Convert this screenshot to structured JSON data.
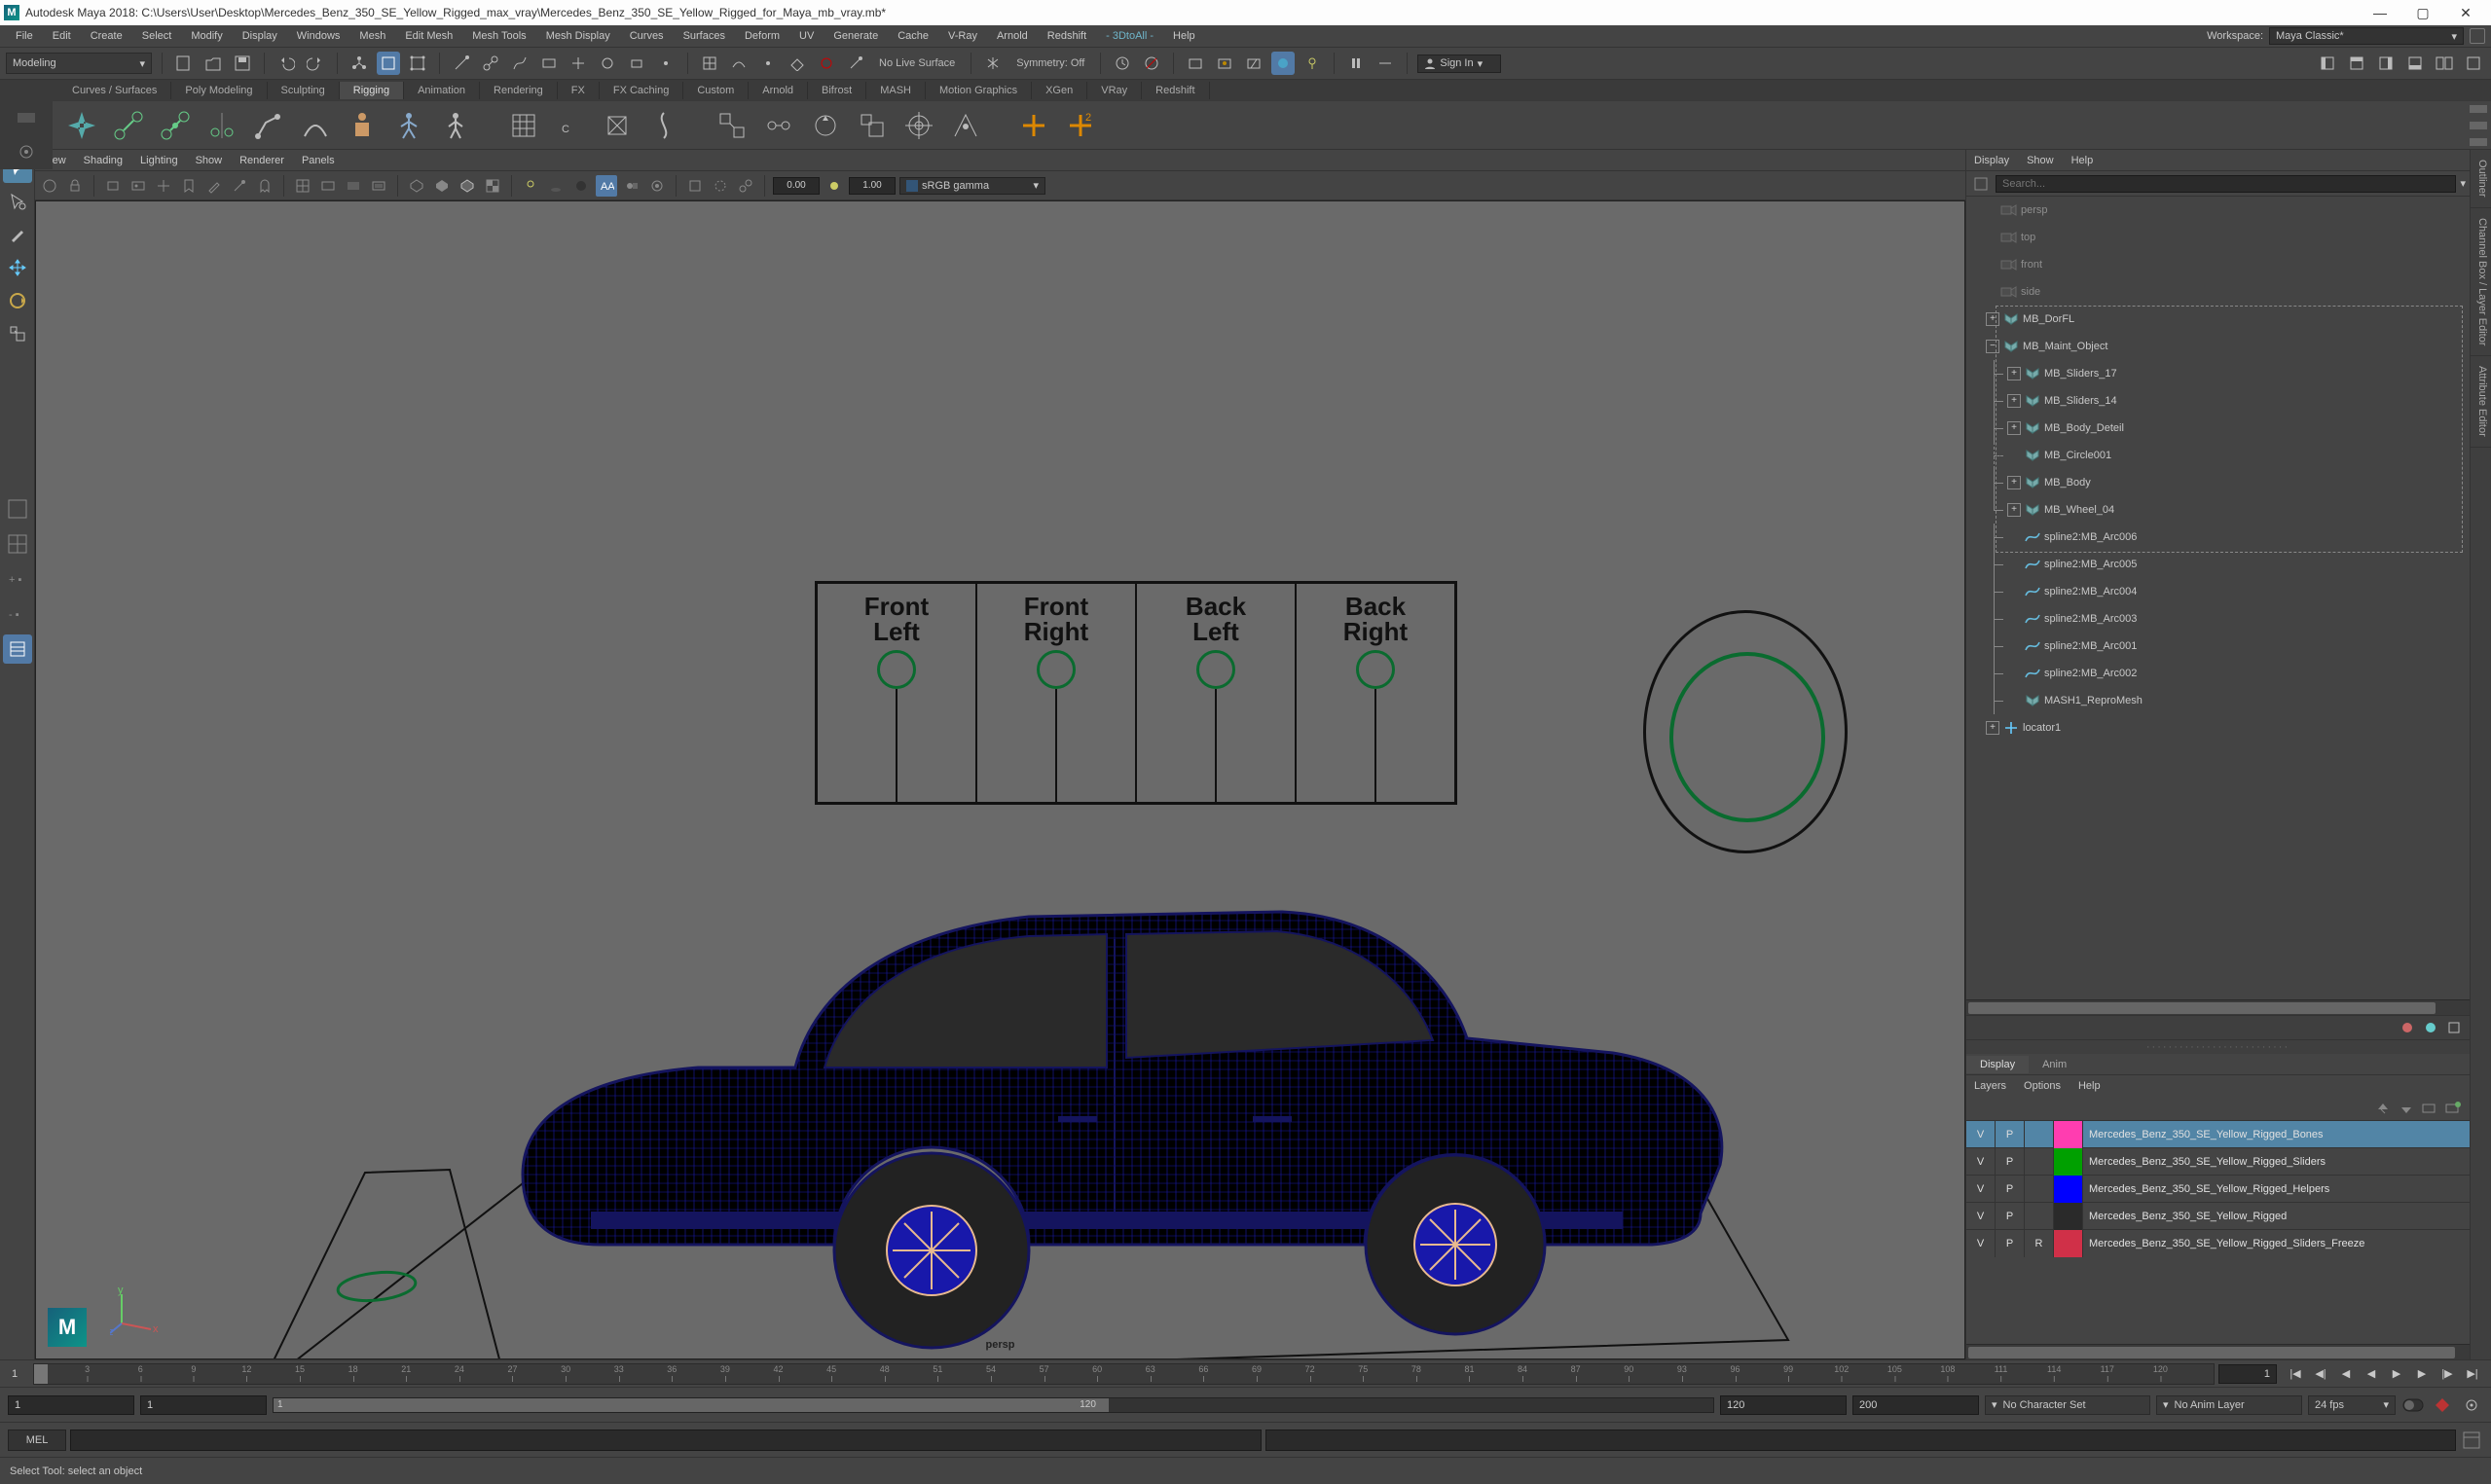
{
  "title": "Autodesk Maya 2018: C:\\Users\\User\\Desktop\\Mercedes_Benz_350_SE_Yellow_Rigged_max_vray\\Mercedes_Benz_350_SE_Yellow_Rigged_for_Maya_mb_vray.mb*",
  "menubar": [
    "File",
    "Edit",
    "Create",
    "Select",
    "Modify",
    "Display",
    "Windows",
    "Mesh",
    "Edit Mesh",
    "Mesh Tools",
    "Mesh Display",
    "Curves",
    "Surfaces",
    "Deform",
    "UV",
    "Generate",
    "Cache",
    "V-Ray",
    "Arnold",
    "Redshift"
  ],
  "menubar_plugins": [
    "- 3DtoAll -",
    "Help"
  ],
  "workspace_label": "Workspace:",
  "workspace_value": "Maya Classic*",
  "modeling_menu": "Modeling",
  "symmetry": "Symmetry: Off",
  "no_live_surface": "No Live Surface",
  "signin": "Sign In",
  "shelf_tabs": [
    "Curves / Surfaces",
    "Poly Modeling",
    "Sculpting",
    "Rigging",
    "Animation",
    "Rendering",
    "FX",
    "FX Caching",
    "Custom",
    "Arnold",
    "Bifrost",
    "MASH",
    "Motion Graphics",
    "XGen",
    "VRay",
    "Redshift"
  ],
  "shelf_active": "Rigging",
  "viewport_menu": [
    "View",
    "Shading",
    "Lighting",
    "Show",
    "Renderer",
    "Panels"
  ],
  "vp_num1": "0.00",
  "vp_num2": "1.00",
  "vp_gamma": "sRGB gamma",
  "persp_label": "persp",
  "rig_labels": [
    [
      "Front",
      "Left"
    ],
    [
      "Front",
      "Right"
    ],
    [
      "Back",
      "Left"
    ],
    [
      "Back",
      "Right"
    ]
  ],
  "outliner_menu": [
    "Display",
    "Show",
    "Help"
  ],
  "outliner_search_placeholder": "Search...",
  "outliner_cameras": [
    "persp",
    "top",
    "front",
    "side"
  ],
  "outliner_tree": [
    {
      "depth": 0,
      "exp": "+",
      "icon": "grp",
      "name": "MB_DorFL"
    },
    {
      "depth": 0,
      "exp": "-",
      "icon": "grp",
      "name": "MB_Maint_Object"
    },
    {
      "depth": 1,
      "exp": "+",
      "icon": "grp",
      "name": "MB_Sliders_17"
    },
    {
      "depth": 1,
      "exp": "+",
      "icon": "grp",
      "name": "MB_Sliders_14"
    },
    {
      "depth": 1,
      "exp": "+",
      "icon": "grp",
      "name": "MB_Body_Deteil"
    },
    {
      "depth": 1,
      "exp": "",
      "icon": "grp",
      "name": "MB_Circle001",
      "dash": true
    },
    {
      "depth": 1,
      "exp": "+",
      "icon": "grp",
      "name": "MB_Body"
    },
    {
      "depth": 1,
      "exp": "+",
      "icon": "grp",
      "name": "MB_Wheel_04",
      "last": true
    },
    {
      "depth": 1,
      "exp": "",
      "icon": "spline",
      "name": "spline2:MB_Arc006"
    },
    {
      "depth": 1,
      "exp": "",
      "icon": "spline",
      "name": "spline2:MB_Arc005"
    },
    {
      "depth": 1,
      "exp": "",
      "icon": "spline",
      "name": "spline2:MB_Arc004"
    },
    {
      "depth": 1,
      "exp": "",
      "icon": "spline",
      "name": "spline2:MB_Arc003"
    },
    {
      "depth": 1,
      "exp": "",
      "icon": "spline",
      "name": "spline2:MB_Arc001"
    },
    {
      "depth": 1,
      "exp": "",
      "icon": "spline",
      "name": "spline2:MB_Arc002"
    },
    {
      "depth": 1,
      "exp": "",
      "icon": "grp",
      "name": "MASH1_ReproMesh"
    },
    {
      "depth": 0,
      "exp": "+",
      "icon": "loc",
      "name": "locator1"
    }
  ],
  "layer_tabs": [
    "Display",
    "Anim"
  ],
  "layer_menu": [
    "Layers",
    "Options",
    "Help"
  ],
  "layers": [
    {
      "v": "V",
      "p": "P",
      "r": "",
      "color": "#ff3db0",
      "name": "Mercedes_Benz_350_SE_Yellow_Rigged_Bones",
      "sel": true
    },
    {
      "v": "V",
      "p": "P",
      "r": "",
      "color": "#00a000",
      "name": "Mercedes_Benz_350_SE_Yellow_Rigged_Sliders"
    },
    {
      "v": "V",
      "p": "P",
      "r": "",
      "color": "#0000ff",
      "name": "Mercedes_Benz_350_SE_Yellow_Rigged_Helpers"
    },
    {
      "v": "V",
      "p": "P",
      "r": "",
      "color": "#2a2a2a",
      "name": "Mercedes_Benz_350_SE_Yellow_Rigged"
    },
    {
      "v": "V",
      "p": "P",
      "r": "R",
      "color": "#d03048",
      "name": "Mercedes_Benz_350_SE_Yellow_Rigged_Sliders_Freeze"
    }
  ],
  "vertical_tabs": [
    "Outliner",
    "Channel Box / Layer Editor",
    "Attribute Editor"
  ],
  "timeline_ticks": [
    "3",
    "6",
    "9",
    "12",
    "15",
    "18",
    "21",
    "24",
    "27",
    "30",
    "33",
    "36",
    "39",
    "42",
    "45",
    "48",
    "51",
    "54",
    "57",
    "60",
    "63",
    "66",
    "69",
    "72",
    "75",
    "78",
    "81",
    "84",
    "87",
    "90",
    "93",
    "96",
    "99",
    "102",
    "105",
    "108",
    "111",
    "114",
    "117",
    "120"
  ],
  "timeline_current": "1",
  "range_start_outer": "1",
  "range_start_inner": "1",
  "range_end_inner": "120",
  "range_end_outer": "120",
  "range_end_outer2": "200",
  "char_set": "No Character Set",
  "anim_layer": "No Anim Layer",
  "fps": "24 fps",
  "cmd_label": "MEL",
  "status_text": "Select Tool: select an object"
}
